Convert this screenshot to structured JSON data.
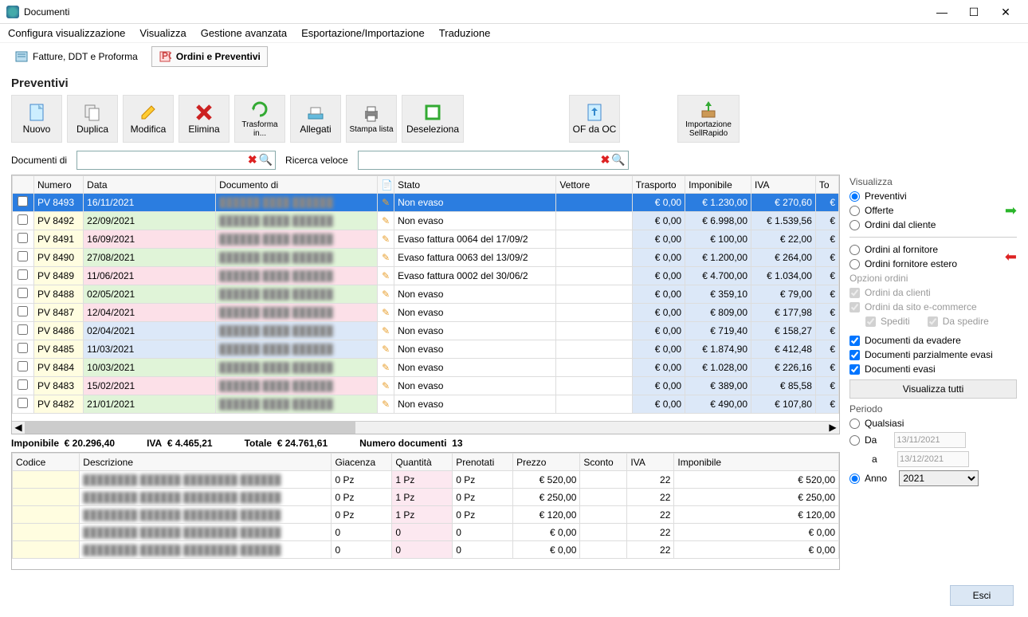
{
  "window": {
    "title": "Documenti"
  },
  "menu": [
    "Configura visualizzazione",
    "Visualizza",
    "Gestione avanzata",
    "Esportazione/Importazione",
    "Traduzione"
  ],
  "tabs": [
    {
      "label": "Fatture, DDT e Proforma",
      "active": false
    },
    {
      "label": "Ordini e Preventivi",
      "active": true
    }
  ],
  "heading": "Preventivi",
  "toolbar": [
    {
      "id": "nuovo",
      "label": "Nuovo"
    },
    {
      "id": "duplica",
      "label": "Duplica"
    },
    {
      "id": "modifica",
      "label": "Modifica"
    },
    {
      "id": "elimina",
      "label": "Elimina"
    },
    {
      "id": "trasforma",
      "label": "Trasforma in..."
    },
    {
      "id": "allegati",
      "label": "Allegati"
    },
    {
      "id": "stampa",
      "label": "Stampa lista"
    },
    {
      "id": "deseleziona",
      "label": "Deseleziona"
    },
    {
      "id": "ofdaoc",
      "label": "OF da OC"
    },
    {
      "id": "sellrapido",
      "label": "Importazione SellRapido"
    }
  ],
  "search": {
    "doc_label": "Documenti di",
    "quick_label": "Ricerca veloce",
    "doc_value": "",
    "quick_value": ""
  },
  "grid": {
    "headers": [
      "",
      "Numero",
      "Data",
      "Documento di",
      "",
      "Stato",
      "Vettore",
      "Trasporto",
      "Imponibile",
      "IVA",
      "To"
    ],
    "rows": [
      {
        "num": "PV 8493",
        "data": "16/11/2021",
        "stato": "Non evaso",
        "tras": "€ 0,00",
        "imp": "€ 1.230,00",
        "iva": "€ 270,60",
        "tot": "€",
        "sel": true,
        "bg": "bg-green"
      },
      {
        "num": "PV 8492",
        "data": "22/09/2021",
        "stato": "Non evaso",
        "tras": "€ 0,00",
        "imp": "€ 6.998,00",
        "iva": "€ 1.539,56",
        "tot": "€",
        "bg": "bg-green"
      },
      {
        "num": "PV 8491",
        "data": "16/09/2021",
        "stato": "Evaso fattura 0064 del 17/09/2",
        "tras": "€ 0,00",
        "imp": "€ 100,00",
        "iva": "€ 22,00",
        "tot": "€",
        "bg": "bg-pink"
      },
      {
        "num": "PV 8490",
        "data": "27/08/2021",
        "stato": "Evaso fattura 0063 del 13/09/2",
        "tras": "€ 0,00",
        "imp": "€ 1.200,00",
        "iva": "€ 264,00",
        "tot": "€",
        "bg": "bg-green"
      },
      {
        "num": "PV 8489",
        "data": "11/06/2021",
        "stato": "Evaso fattura 0002 del 30/06/2",
        "tras": "€ 0,00",
        "imp": "€ 4.700,00",
        "iva": "€ 1.034,00",
        "tot": "€",
        "bg": "bg-pink"
      },
      {
        "num": "PV 8488",
        "data": "02/05/2021",
        "stato": "Non evaso",
        "tras": "€ 0,00",
        "imp": "€ 359,10",
        "iva": "€ 79,00",
        "tot": "€",
        "bg": "bg-green"
      },
      {
        "num": "PV 8487",
        "data": "12/04/2021",
        "stato": "Non evaso",
        "tras": "€ 0,00",
        "imp": "€ 809,00",
        "iva": "€ 177,98",
        "tot": "€",
        "bg": "bg-pink"
      },
      {
        "num": "PV 8486",
        "data": "02/04/2021",
        "stato": "Non evaso",
        "tras": "€ 0,00",
        "imp": "€ 719,40",
        "iva": "€ 158,27",
        "tot": "€",
        "bg": "bg-blue"
      },
      {
        "num": "PV 8485",
        "data": "11/03/2021",
        "stato": "Non evaso",
        "tras": "€ 0,00",
        "imp": "€ 1.874,90",
        "iva": "€ 412,48",
        "tot": "€",
        "bg": "bg-blue"
      },
      {
        "num": "PV 8484",
        "data": "10/03/2021",
        "stato": "Non evaso",
        "tras": "€ 0,00",
        "imp": "€ 1.028,00",
        "iva": "€ 226,16",
        "tot": "€",
        "bg": "bg-green"
      },
      {
        "num": "PV 8483",
        "data": "15/02/2021",
        "stato": "Non evaso",
        "tras": "€ 0,00",
        "imp": "€ 389,00",
        "iva": "€ 85,58",
        "tot": "€",
        "bg": "bg-pink"
      },
      {
        "num": "PV 8482",
        "data": "21/01/2021",
        "stato": "Non evaso",
        "tras": "€ 0,00",
        "imp": "€ 490,00",
        "iva": "€ 107,80",
        "tot": "€",
        "bg": "bg-green"
      }
    ]
  },
  "totals": {
    "imp_label": "Imponibile",
    "imp_val": "€ 20.296,40",
    "iva_label": "IVA",
    "iva_val": "€ 4.465,21",
    "tot_label": "Totale",
    "tot_val": "€ 24.761,61",
    "num_label": "Numero documenti",
    "num_val": "13"
  },
  "detail": {
    "headers": [
      "Codice",
      "Descrizione",
      "Giacenza",
      "Quantità",
      "Prenotati",
      "Prezzo",
      "Sconto",
      "IVA",
      "Imponibile"
    ],
    "rows": [
      {
        "gia": "0 Pz",
        "qta": "1 Pz",
        "pre": "0 Pz",
        "prz": "€ 520,00",
        "sco": "",
        "iva": "22",
        "imp": "€ 520,00"
      },
      {
        "gia": "0 Pz",
        "qta": "1 Pz",
        "pre": "0 Pz",
        "prz": "€ 250,00",
        "sco": "",
        "iva": "22",
        "imp": "€ 250,00"
      },
      {
        "gia": "0 Pz",
        "qta": "1 Pz",
        "pre": "0 Pz",
        "prz": "€ 120,00",
        "sco": "",
        "iva": "22",
        "imp": "€ 120,00"
      },
      {
        "gia": "0",
        "qta": "0",
        "pre": "0",
        "prz": "€ 0,00",
        "sco": "",
        "iva": "22",
        "imp": "€ 0,00"
      },
      {
        "gia": "0",
        "qta": "0",
        "pre": "0",
        "prz": "€ 0,00",
        "sco": "",
        "iva": "22",
        "imp": "€ 0,00"
      }
    ]
  },
  "side": {
    "visual_title": "Visualizza",
    "radios1": [
      "Preventivi",
      "Offerte",
      "Ordini dal cliente"
    ],
    "radios2": [
      "Ordini al fornitore",
      "Ordini fornitore estero"
    ],
    "opz_title": "Opzioni ordini",
    "opz": [
      "Ordini da clienti",
      "Ordini da sito e-commerce"
    ],
    "opz_sub": [
      "Spediti",
      "Da spedire"
    ],
    "checks": [
      "Documenti da evadere",
      "Documenti parzialmente evasi",
      "Documenti evasi"
    ],
    "btn_vis": "Visualizza tutti",
    "periodo_title": "Periodo",
    "periodo_radios": [
      "Qualsiasi",
      "Da",
      "Anno"
    ],
    "periodo_a": "a",
    "date_from": "13/11/2021",
    "date_to": "13/12/2021",
    "anno": "2021",
    "esci": "Esci"
  }
}
